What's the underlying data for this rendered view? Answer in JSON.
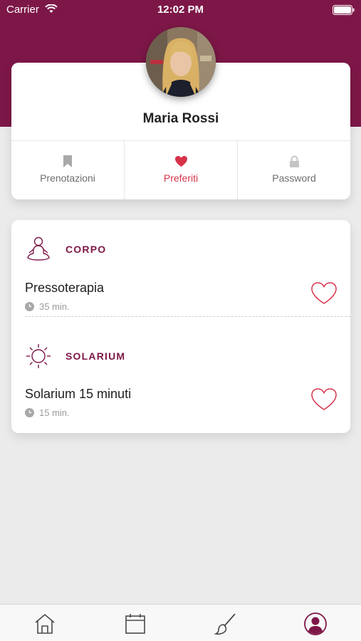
{
  "status_bar": {
    "carrier": "Carrier",
    "time": "12:02 PM"
  },
  "profile": {
    "name": "Maria Rossi",
    "tabs": [
      {
        "label": "Prenotazioni",
        "icon": "bookmark-icon",
        "active": false
      },
      {
        "label": "Preferiti",
        "icon": "heart-icon",
        "active": true
      },
      {
        "label": "Password",
        "icon": "lock-icon",
        "active": false
      }
    ]
  },
  "favorites": {
    "categories": [
      {
        "name": "CORPO",
        "icon": "yoga-figure-icon",
        "items": [
          {
            "name": "Pressoterapia",
            "duration": "35 min."
          }
        ]
      },
      {
        "name": "SOLARIUM",
        "icon": "sun-icon",
        "items": [
          {
            "name": "Solarium 15 minuti",
            "duration": "15 min."
          }
        ]
      }
    ]
  },
  "tab_bar": {
    "items": [
      "home-icon",
      "calendar-icon",
      "brush-icon",
      "profile-icon"
    ],
    "active": "profile-icon"
  },
  "colors": {
    "brand": "#7d1747",
    "accent_red": "#d7334b",
    "background": "#ebebeb"
  }
}
